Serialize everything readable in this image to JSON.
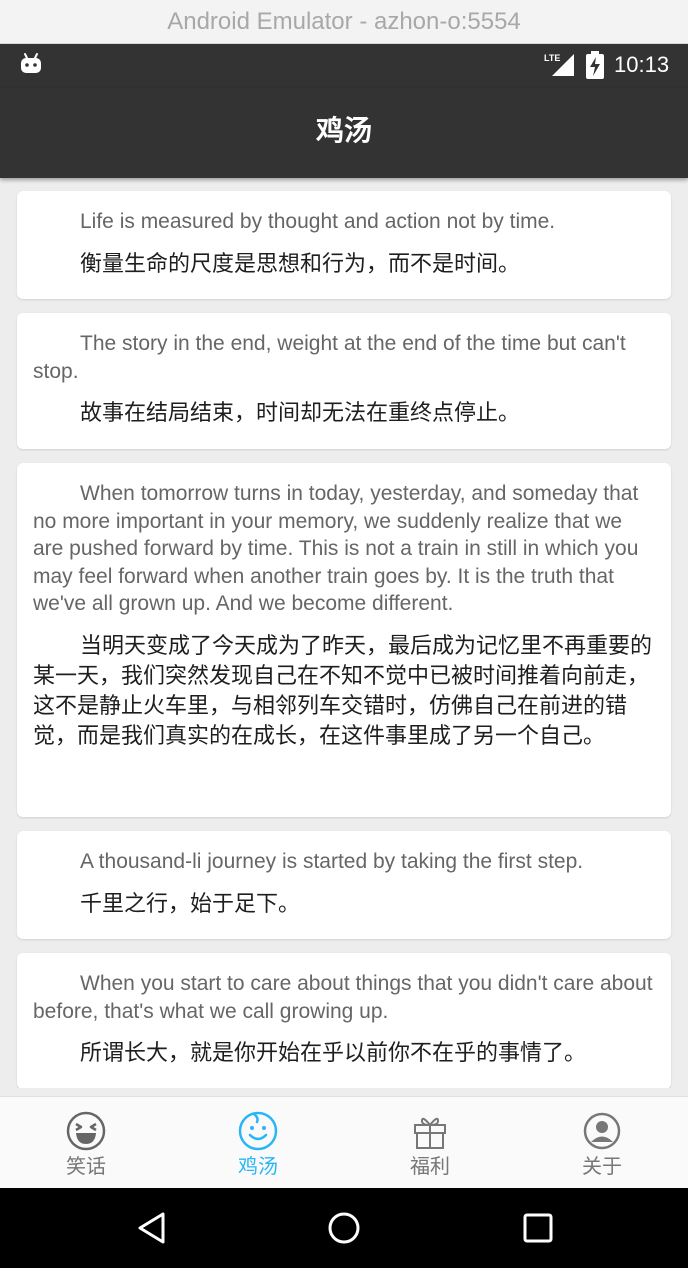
{
  "window": {
    "title": "Android Emulator - azhon-o:5554"
  },
  "statusbar": {
    "time": "10:13",
    "network": "LTE"
  },
  "appbar": {
    "title": "鸡汤"
  },
  "quotes": [
    {
      "en": "Life is measured by thought and action not by time.",
      "zh": "衡量生命的尺度是思想和行为，而不是时间。"
    },
    {
      "en": "The story in the end, weight at the end of the time but can't stop.",
      "zh": "故事在结局结束，时间却无法在重终点停止。"
    },
    {
      "en": "When tomorrow turns in today, yesterday, and someday that no more important in your memory, we suddenly realize that we are pushed forward by time. This is not a train in still in which you may feel forward when another train goes by. It is the truth that we've all grown up. And we become different.",
      "zh": "当明天变成了今天成为了昨天，最后成为记忆里不再重要的某一天，我们突然发现自己在不知不觉中已被时间推着向前走，这不是静止火车里，与相邻列车交错时，仿佛自己在前进的错觉，而是我们真实的在成长，在这件事里成了另一个自己。"
    },
    {
      "en": "A thousand-li journey is started by taking the first step.",
      "zh": "千里之行，始于足下。"
    },
    {
      "en": "When you start to care about things that you didn't care about before, that's what we call growing up.",
      "zh": "所谓长大，就是你开始在乎以前你不在乎的事情了。"
    }
  ],
  "tabs": [
    {
      "label": "笑话",
      "icon": "laughing-face-icon",
      "active": false
    },
    {
      "label": "鸡汤",
      "icon": "smile-face-icon",
      "active": true
    },
    {
      "label": "福利",
      "icon": "gift-icon",
      "active": false
    },
    {
      "label": "关于",
      "icon": "person-icon",
      "active": false
    }
  ],
  "colors": {
    "accent": "#29b6f6",
    "bar": "#333333",
    "background": "#ededed",
    "inactive_tab": "#777777"
  }
}
